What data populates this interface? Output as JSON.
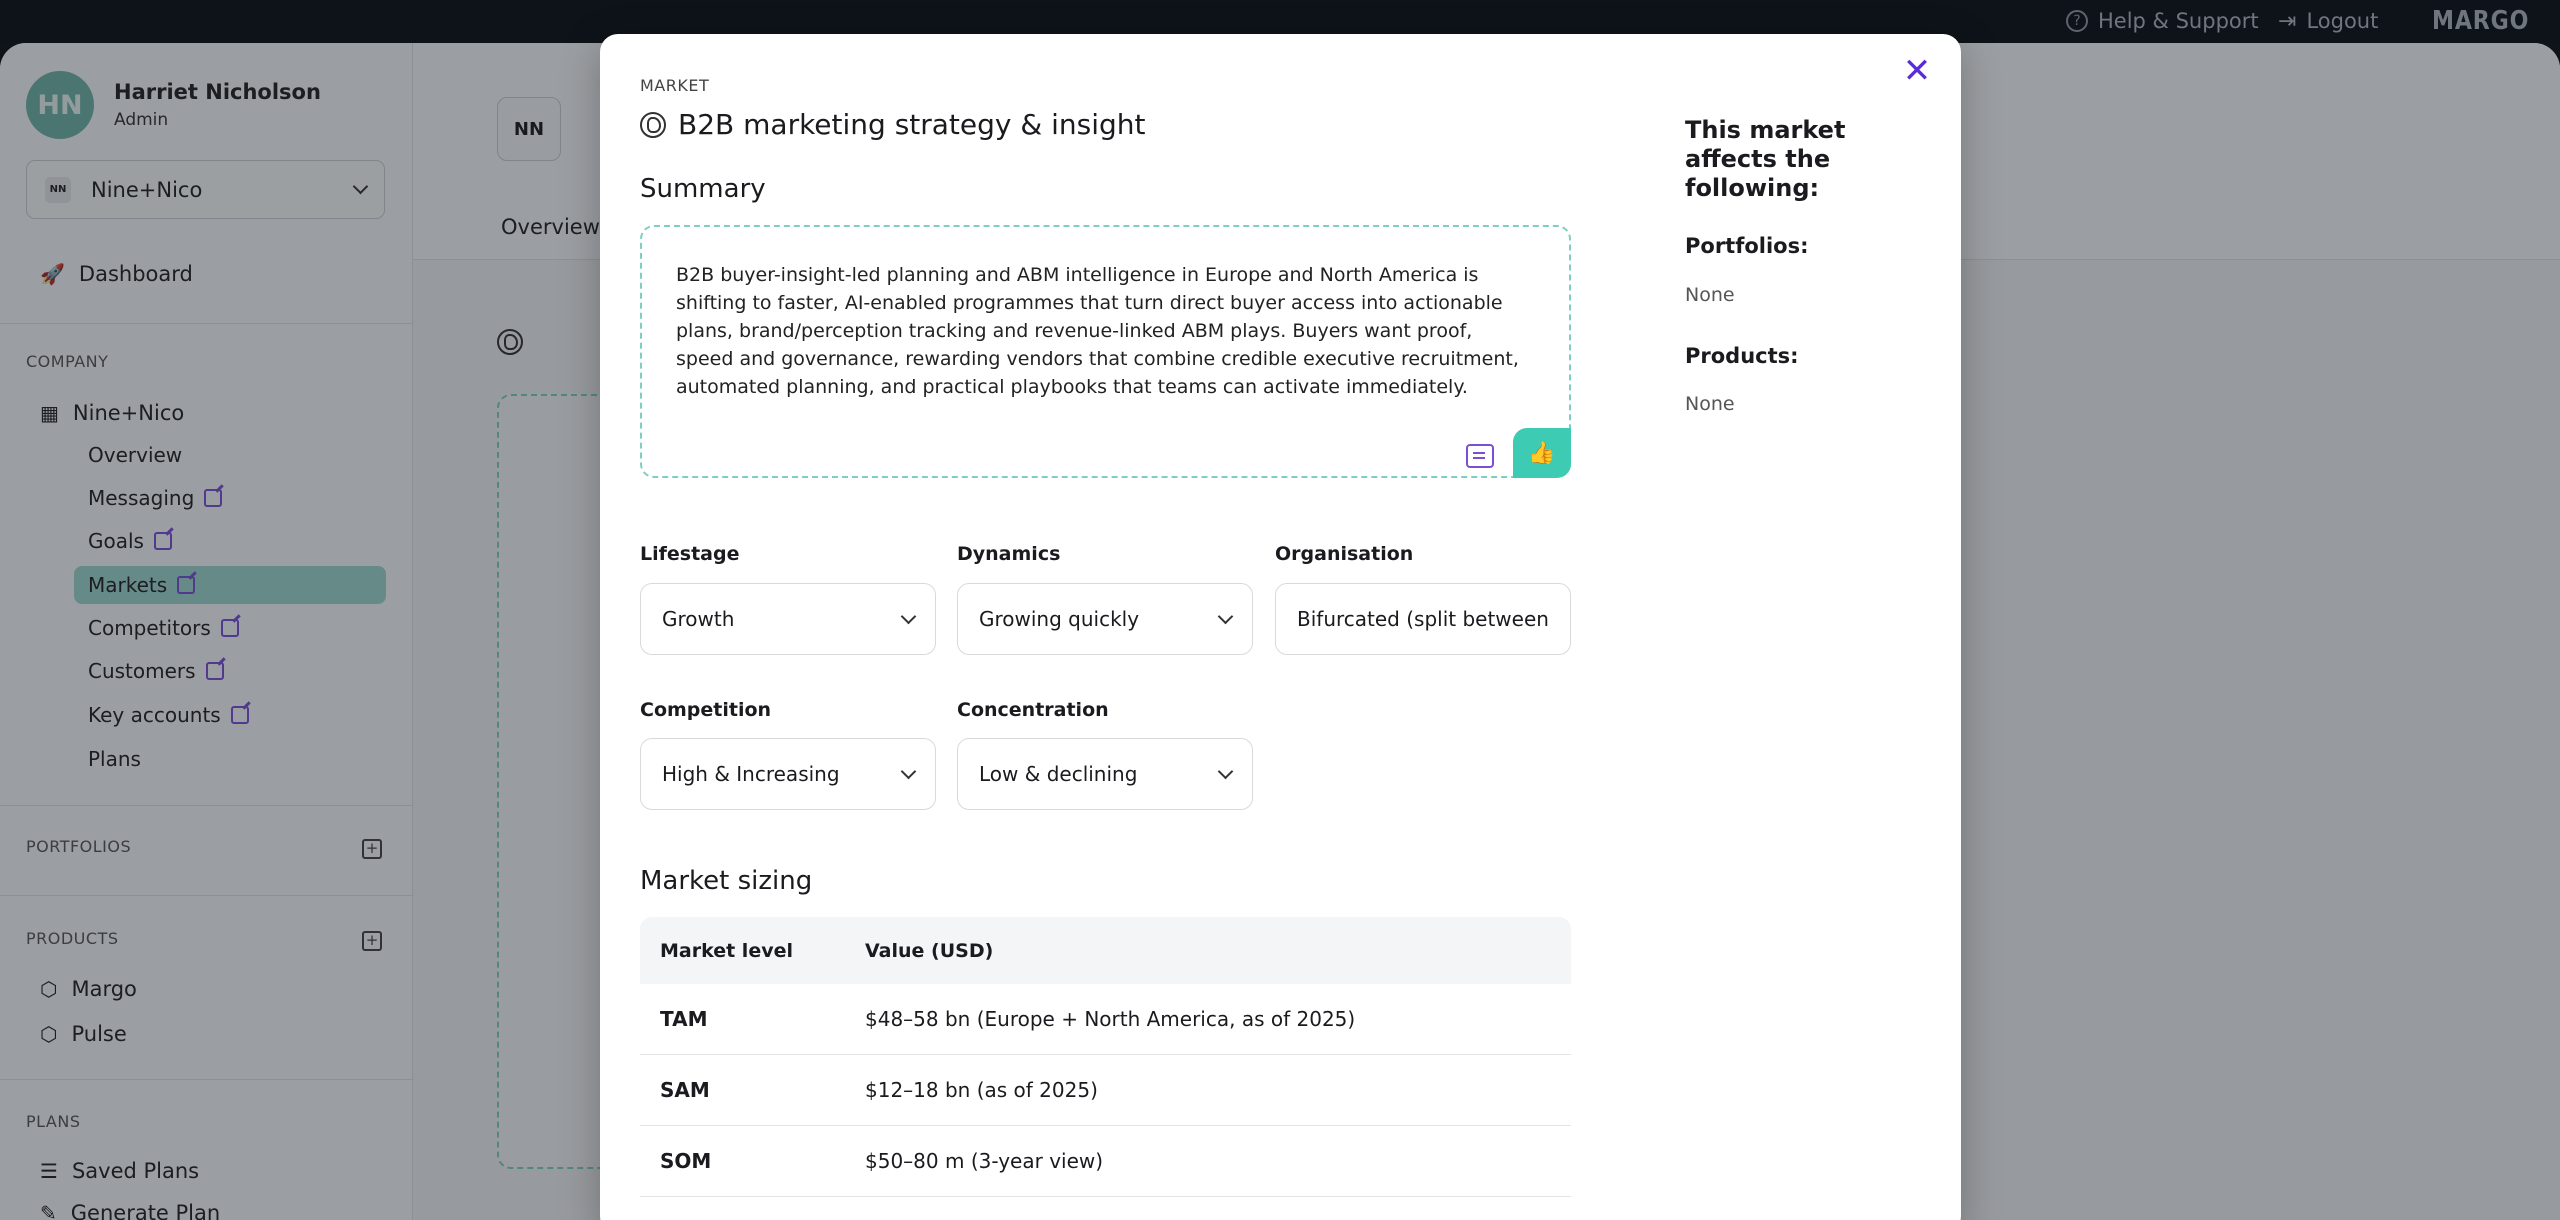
{
  "topbar": {
    "help": "Help & Support",
    "logout": "Logout",
    "brand": "MARGO"
  },
  "user": {
    "initials": "HN",
    "name": "Harriet Nicholson",
    "role": "Admin"
  },
  "company_select": {
    "value": "Nine+Nico",
    "logo_text": "NN"
  },
  "sidebar": {
    "dashboard": "Dashboard",
    "company_label": "COMPANY",
    "company_name": "Nine+Nico",
    "company_items": [
      {
        "label": "Overview"
      },
      {
        "label": "Messaging"
      },
      {
        "label": "Goals"
      },
      {
        "label": "Markets"
      },
      {
        "label": "Competitors"
      },
      {
        "label": "Customers"
      },
      {
        "label": "Key accounts"
      },
      {
        "label": "Plans"
      }
    ],
    "portfolios_label": "PORTFOLIOS",
    "products_label": "PRODUCTS",
    "products": [
      {
        "label": "Margo"
      },
      {
        "label": "Pulse"
      }
    ],
    "plans_label": "PLANS",
    "plans": [
      {
        "label": "Saved Plans"
      },
      {
        "label": "Generate Plan"
      }
    ]
  },
  "background": {
    "logo_text": "NN",
    "tab_overview": "Overview"
  },
  "modal": {
    "kicker": "MARKET",
    "title": "B2B marketing strategy & insight",
    "summary_heading": "Summary",
    "summary_text": "B2B buyer-insight-led planning and ABM intelligence in Europe and North America is shifting to faster, AI-enabled programmes that turn direct buyer access into actionable plans, brand/perception tracking and revenue-linked ABM plays. Buyers want proof, speed and governance, rewarding vendors that combine credible executive recruitment, automated planning, and practical playbooks that teams can activate immediately.",
    "fields": {
      "lifestage": {
        "label": "Lifestage",
        "value": "Growth"
      },
      "dynamics": {
        "label": "Dynamics",
        "value": "Growing quickly"
      },
      "organisation": {
        "label": "Organisation",
        "value": "Bifurcated (split between"
      },
      "competition": {
        "label": "Competition",
        "value": "High & Increasing"
      },
      "concentration": {
        "label": "Concentration",
        "value": "Low & declining"
      }
    },
    "sizing_heading": "Market sizing",
    "sizing_table": {
      "headers": [
        "Market level",
        "Value (USD)"
      ],
      "rows": [
        {
          "level": "TAM",
          "value": "$48–58 bn (Europe + North America, as of 2025)"
        },
        {
          "level": "SAM",
          "value": "$12–18 bn (as of 2025)"
        },
        {
          "level": "SOM",
          "value": "$50–80 m (3-year view)"
        }
      ]
    },
    "affects": {
      "heading": "This market affects the following:",
      "portfolios_label": "Portfolios:",
      "portfolios_value": "None",
      "products_label": "Products:",
      "products_value": "None"
    }
  }
}
